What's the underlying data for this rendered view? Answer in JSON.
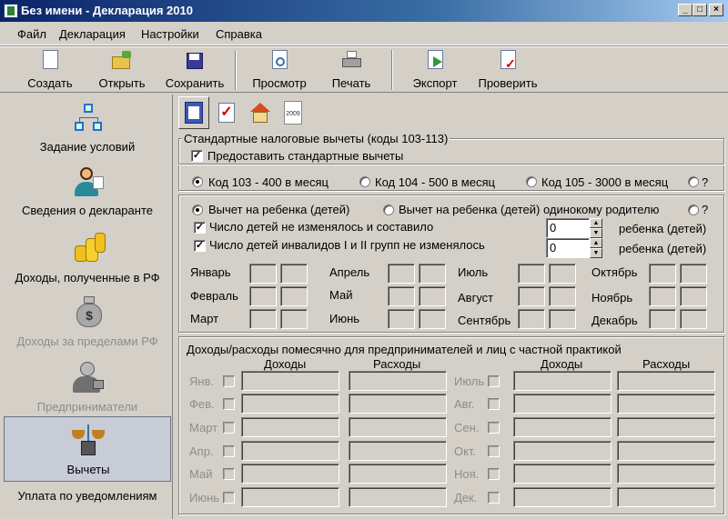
{
  "window": {
    "title": "Без имени - Декларация 2010",
    "controls": [
      "_",
      "□",
      "×"
    ]
  },
  "menu": [
    "Файл",
    "Декларация",
    "Настройки",
    "Справка"
  ],
  "toolbar": {
    "create": "Создать",
    "open": "Открыть",
    "save": "Сохранить",
    "preview": "Просмотр",
    "print": "Печать",
    "export": "Экспорт",
    "check": "Проверить"
  },
  "sidebar": {
    "conditions": "Задание условий",
    "declarant": "Сведения о декларанте",
    "income_rf": "Доходы, полученные в РФ",
    "income_abroad": "Доходы за пределами РФ",
    "entrepreneurs": "Предприниматели",
    "deductions": "Вычеты",
    "payment": "Уплата по уведомлениям"
  },
  "tabs": {
    "year_icon_text": "2009"
  },
  "standard": {
    "legend": "Стандартные налоговые вычеты (коды 103-113)",
    "provide": "Предоставить стандартные вычеты",
    "code103": "Код 103 - 400 в месяц",
    "code104": "Код 104 - 500 в месяц",
    "code105": "Код 105 - 3000 в месяц",
    "help": "?"
  },
  "child": {
    "child_deduction": "Вычет на ребенка (детей)",
    "single_parent": "Вычет на ребенка (детей) одинокому родителю",
    "help": "?",
    "unchanged": "Число детей не изменялось и составило",
    "disabled_unchanged": "Число детей инвалидов I и II групп не изменялось",
    "count1": "0",
    "count2": "0",
    "unit1": "ребенка (детей)",
    "unit2": "ребенка (детей)"
  },
  "months": {
    "jan": "Январь",
    "feb": "Февраль",
    "mar": "Март",
    "apr": "Апрель",
    "may": "Май",
    "jun": "Июнь",
    "jul": "Июль",
    "aug": "Август",
    "sep": "Сентябрь",
    "oct": "Октябрь",
    "nov": "Ноябрь",
    "dec": "Декабрь"
  },
  "monthly": {
    "legend": "Доходы/расходы помесячно для предпринимателей и лиц с частной практикой",
    "income": "Доходы",
    "expenses": "Расходы",
    "income2": "Доходы",
    "expenses2": "Расходы",
    "left": [
      "Янв.",
      "Фев.",
      "Март",
      "Апр.",
      "Май",
      "Июнь"
    ],
    "right": [
      "Июль",
      "Авг.",
      "Сен.",
      "Окт.",
      "Ноя.",
      "Дек."
    ]
  }
}
